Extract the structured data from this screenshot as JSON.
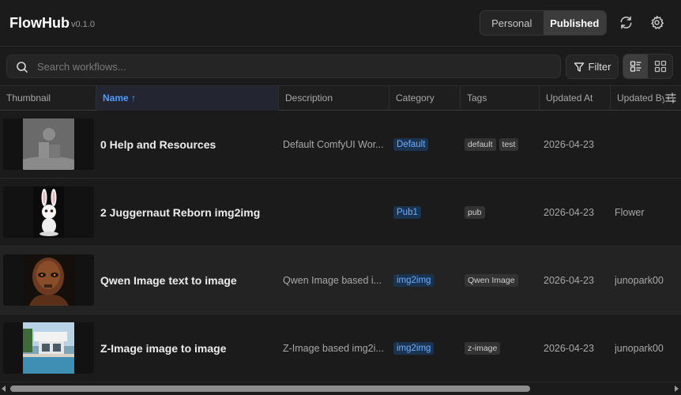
{
  "app": {
    "title": "FlowHub",
    "version": "v0.1.0"
  },
  "header": {
    "segments": [
      {
        "label": "Personal",
        "active": false
      },
      {
        "label": "Published",
        "active": true
      }
    ],
    "refresh_icon": "refresh-icon",
    "settings_icon": "gear-icon"
  },
  "toolbar": {
    "search_placeholder": "Search workflows...",
    "search_value": "",
    "filter_label": "Filter",
    "view_modes": [
      {
        "name": "list-view",
        "active": true
      },
      {
        "name": "grid-view",
        "active": false
      }
    ]
  },
  "table": {
    "columns": [
      "Thumbnail",
      "Name",
      "Description",
      "Category",
      "Tags",
      "Updated At",
      "Updated By"
    ],
    "sort": {
      "column": "Name",
      "direction": "asc",
      "arrow": "↑"
    },
    "rows": [
      {
        "thumbnail": "placeholder-image",
        "name": "0 Help and Resources",
        "description": "Default ComfyUI Wor...",
        "category": "Default",
        "tags": [
          "default",
          "test"
        ],
        "updated_at": "2026-04-23",
        "updated_by": ""
      },
      {
        "thumbnail": "bunny-image",
        "name": "2 Juggernaut Reborn img2img",
        "description": "",
        "category": "Pub1",
        "tags": [
          "pub"
        ],
        "updated_at": "2026-04-23",
        "updated_by": "Flower"
      },
      {
        "thumbnail": "robot-portrait-image",
        "name": "Qwen Image text to image",
        "description": "Qwen Image based i...",
        "category": "img2img",
        "tags": [
          "Qwen Image"
        ],
        "updated_at": "2026-04-23",
        "updated_by": "junopark00"
      },
      {
        "thumbnail": "modern-house-image",
        "name": "Z-Image image to image",
        "description": "Z-Image based img2i...",
        "category": "img2img",
        "tags": [
          "z-image"
        ],
        "updated_at": "2026-04-23",
        "updated_by": "junopark00"
      }
    ]
  },
  "colors": {
    "background": "#1b1b1b",
    "accent": "#4f9bff",
    "badge_bg": "#1a3350",
    "tag_bg": "#333333"
  }
}
